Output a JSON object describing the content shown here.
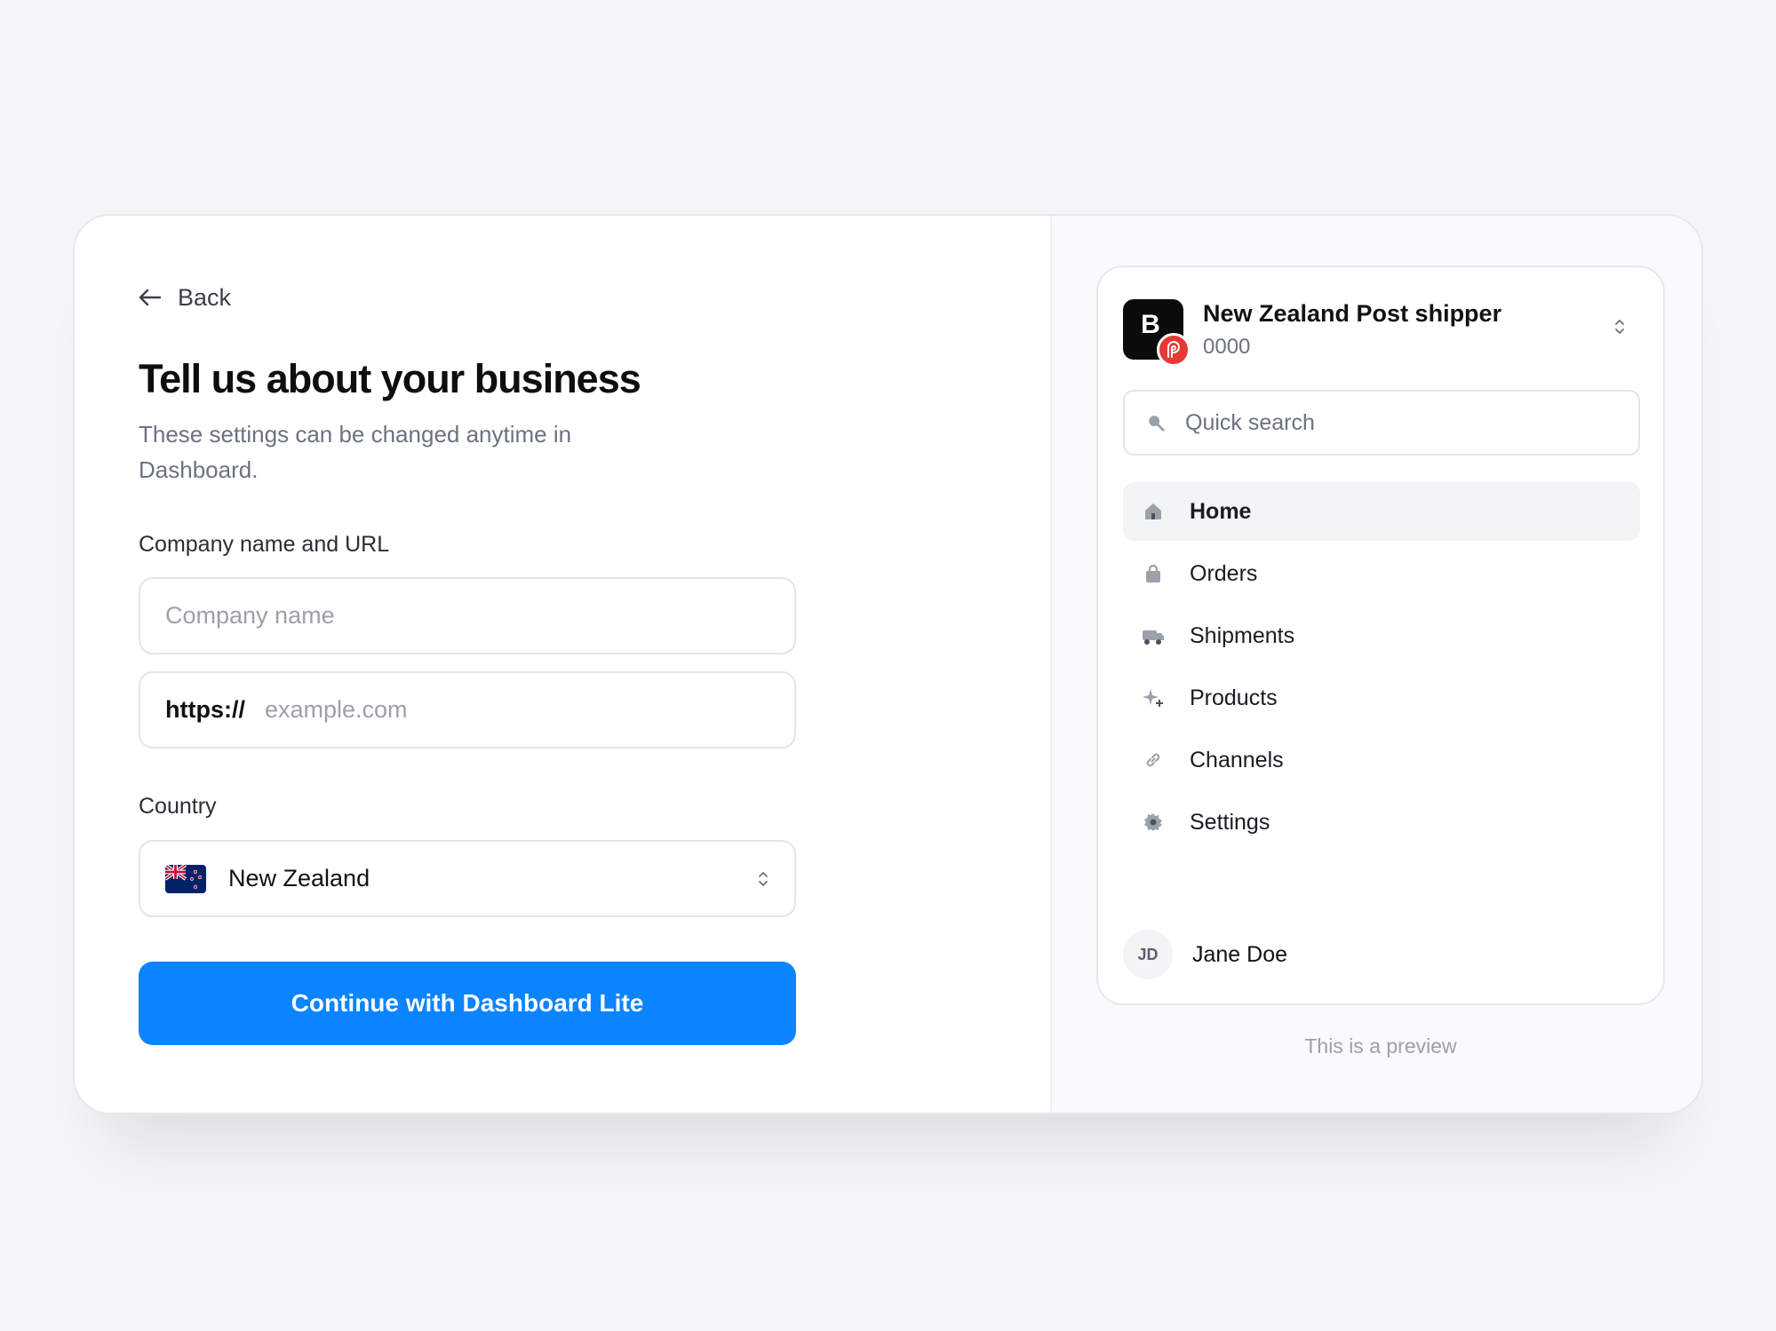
{
  "form": {
    "back_label": "Back",
    "title": "Tell us about your business",
    "subtitle": "These settings can be changed anytime in Dashboard.",
    "company_label": "Company name and URL",
    "company_placeholder": "Company name",
    "company_value": "",
    "url_prefix": "https://",
    "url_placeholder": "example.com",
    "url_value": "",
    "country_label": "Country",
    "country_value": "New Zealand",
    "submit_label": "Continue with Dashboard Lite"
  },
  "preview": {
    "account": {
      "logo_letter": "B",
      "name": "New Zealand Post shipper",
      "id": "0000"
    },
    "search_placeholder": "Quick search",
    "nav": [
      {
        "label": "Home",
        "icon": "home-icon",
        "active": true
      },
      {
        "label": "Orders",
        "icon": "bag-icon",
        "active": false
      },
      {
        "label": "Shipments",
        "icon": "truck-icon",
        "active": false
      },
      {
        "label": "Products",
        "icon": "sparkle-icon",
        "active": false
      },
      {
        "label": "Channels",
        "icon": "link-icon",
        "active": false
      },
      {
        "label": "Settings",
        "icon": "gear-icon",
        "active": false
      }
    ],
    "user": {
      "initials": "JD",
      "name": "Jane Doe"
    },
    "note": "This is a preview"
  },
  "colors": {
    "primary": "#0a84ff",
    "background": "#f4f5f7",
    "brand_badge": "#e53935"
  }
}
